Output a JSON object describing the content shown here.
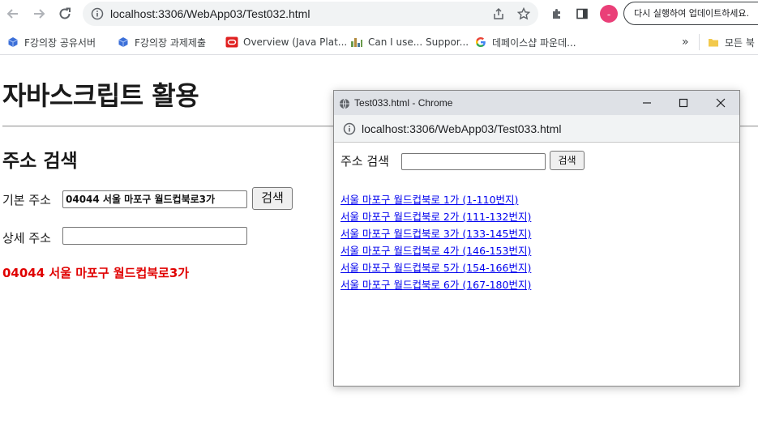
{
  "browser": {
    "url": "localhost:3306/WebApp03/Test032.html",
    "profile_initial": "-",
    "update_button": "다시 실행하여 업데이트하세요.",
    "bookmarks": [
      {
        "label": "F강의장 공유서버"
      },
      {
        "label": "F강의장 과제제출"
      },
      {
        "label": "Overview (Java Plat..."
      },
      {
        "label": "Can I use... Suppor..."
      },
      {
        "label": "데페이스샵 파운데..."
      }
    ],
    "more_bookmarks": "»",
    "all_bookmarks": "모든 북"
  },
  "page": {
    "title": "자바스크립트 활용",
    "section_title": "주소 검색",
    "basic_address_label": "기본 주소",
    "basic_address_value": "04044 서울 마포구 월드컵북로3가",
    "search_button": "검색",
    "detail_address_label": "상세 주소",
    "detail_address_value": "",
    "result_text": "04044 서울 마포구 월드컵북로3가"
  },
  "popup": {
    "title": "Test033.html - Chrome",
    "url": "localhost:3306/WebApp03/Test033.html",
    "search_label": "주소 검색",
    "search_value": "",
    "search_button": "검색",
    "results": [
      "서울 마포구 월드컵북로 1가 (1-110번지)",
      "서울 마포구 월드컵북로 2가 (111-132번지)",
      "서울 마포구 월드컵북로 3가 (133-145번지)",
      "서울 마포구 월드컵북로 4가 (146-153번지)",
      "서울 마포구 월드컵북로 5가 (154-166번지)",
      "서울 마포구 월드컵북로 6가 (167-180번지)"
    ]
  },
  "colors": {
    "result_red": "#e00000",
    "link_blue": "#0000ee",
    "profile_pink": "#ea3f78"
  }
}
